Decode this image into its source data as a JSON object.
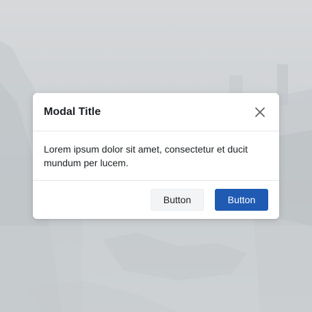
{
  "backdrop": {
    "description_icon": "blurred-landscape-image"
  },
  "modal": {
    "title": "Modal Title",
    "close_icon": "close-icon",
    "body_text": "Lorem ipsum dolor sit amet, consectetur et ducit mundum per lucem.",
    "secondary_button_label": "Button",
    "primary_button_label": "Button"
  },
  "colors": {
    "primary": "#1f5bb3",
    "secondary_bg": "#f3f4f6",
    "text": "#1c1f23",
    "divider": "#e3e5e8"
  }
}
